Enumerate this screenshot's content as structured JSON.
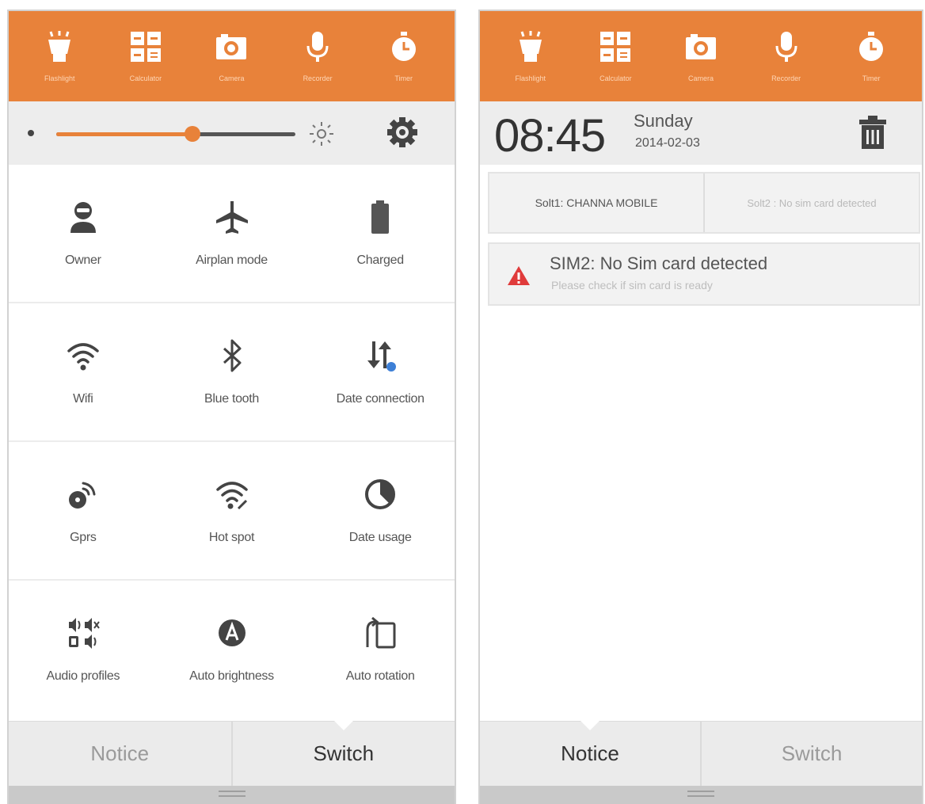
{
  "colors": {
    "accent": "#e8823a",
    "warning": "#e03b3b"
  },
  "app_shortcuts": [
    {
      "label": "Flashlight",
      "icon": "flashlight-icon"
    },
    {
      "label": "Calculator",
      "icon": "calculator-icon"
    },
    {
      "label": "Camera",
      "icon": "camera-icon"
    },
    {
      "label": "Recorder",
      "icon": "recorder-icon"
    },
    {
      "label": "Timer",
      "icon": "timer-icon"
    }
  ],
  "switch_panel": {
    "brightness_level": 0.57,
    "toggles": [
      {
        "label": "Owner",
        "icon": "owner-icon"
      },
      {
        "label": "Airplan mode",
        "icon": "airplane-icon"
      },
      {
        "label": "Charged",
        "icon": "battery-icon"
      },
      {
        "label": "Wifi",
        "icon": "wifi-icon"
      },
      {
        "label": "Blue tooth",
        "icon": "bluetooth-icon"
      },
      {
        "label": "Date connection",
        "icon": "data-connection-icon"
      },
      {
        "label": "Gprs",
        "icon": "gprs-icon"
      },
      {
        "label": "Hot spot",
        "icon": "hotspot-icon"
      },
      {
        "label": "Date usage",
        "icon": "data-usage-icon"
      },
      {
        "label": "Audio profiles",
        "icon": "audio-profiles-icon"
      },
      {
        "label": "Auto brightness",
        "icon": "auto-brightness-icon"
      },
      {
        "label": "Auto rotation",
        "icon": "auto-rotation-icon"
      }
    ]
  },
  "notice_panel": {
    "time": "08:45",
    "weekday": "Sunday",
    "date": "2014-02-03",
    "sim_slots": [
      "Solt1: CHANNA MOBILE",
      "Solt2 : No sim card detected"
    ],
    "notification": {
      "title": "SIM2: No Sim card detected",
      "subtitle": "Please check if sim card is ready"
    }
  },
  "tabs": {
    "notice": "Notice",
    "switch": "Switch"
  }
}
